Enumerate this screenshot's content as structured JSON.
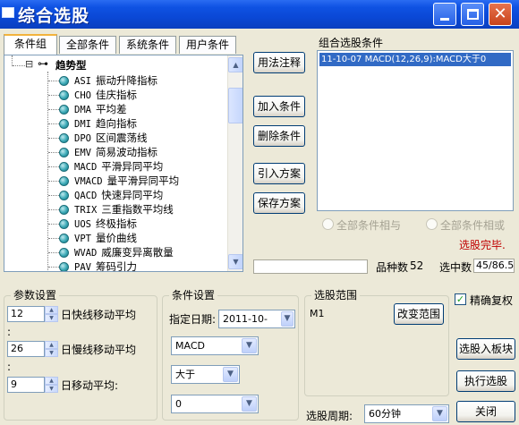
{
  "window": {
    "title": "综合选股"
  },
  "tabs": [
    {
      "label": "条件组"
    },
    {
      "label": "全部条件"
    },
    {
      "label": "系统条件"
    },
    {
      "label": "用户条件"
    }
  ],
  "tree": {
    "group": "趋势型",
    "items": [
      {
        "code": "ASI",
        "name": "振动升降指标"
      },
      {
        "code": "CHO",
        "name": "佳庆指标"
      },
      {
        "code": "DMA",
        "name": "平均差"
      },
      {
        "code": "DMI",
        "name": "趋向指标"
      },
      {
        "code": "DPO",
        "name": "区间震荡线"
      },
      {
        "code": "EMV",
        "name": "简易波动指标"
      },
      {
        "code": "MACD",
        "name": "平滑异同平均"
      },
      {
        "code": "VMACD",
        "name": "量平滑异同平均"
      },
      {
        "code": "QACD",
        "name": "快速异同平均"
      },
      {
        "code": "TRIX",
        "name": "三重指数平均线"
      },
      {
        "code": "UOS",
        "name": "终极指标"
      },
      {
        "code": "VPT",
        "name": "量价曲线"
      },
      {
        "code": "WVAD",
        "name": "威廉变异离散量"
      },
      {
        "code": "PAV",
        "name": "筹码引力"
      }
    ]
  },
  "buttons": {
    "usage": "用法注释",
    "add": "加入条件",
    "delete": "删除条件",
    "import": "引入方案",
    "save": "保存方案",
    "change_range": "改变范围",
    "add_to_block": "选股入板块",
    "execute": "执行选股",
    "close": "关闭"
  },
  "combo_conditions": {
    "title": "组合选股条件",
    "items": [
      "11-10-07 MACD(12,26,9):MACD大于0"
    ]
  },
  "logic": {
    "all_and": "全部条件相与",
    "all_or": "全部条件相或"
  },
  "status": {
    "done_text": "选股完毕.",
    "variety_label": "品种数",
    "variety_count": "52",
    "selected_label": "选中数",
    "selected_value": "45/86.5"
  },
  "params": {
    "title": "参数设置",
    "rows": [
      {
        "value": "12",
        "label": "日快线移动平均"
      },
      {
        "value": "26",
        "label": "日慢线移动平均"
      },
      {
        "value": "9",
        "label": "日移动平均:"
      }
    ],
    "colon": ":"
  },
  "condition_settings": {
    "title": "条件设置",
    "date_label": "指定日期:",
    "date_value": "2011-10-",
    "indicator": "MACD",
    "operator": "大于",
    "value": "0"
  },
  "range": {
    "title": "选股范围",
    "value": "M1"
  },
  "accurate_restore": {
    "label": "精确复权",
    "checked": true
  },
  "period": {
    "label": "选股周期:",
    "value": "60分钟"
  },
  "colors": {
    "title_blue": "#0a48d6",
    "selection_blue": "#316ac5",
    "done_red": "#c00000"
  }
}
